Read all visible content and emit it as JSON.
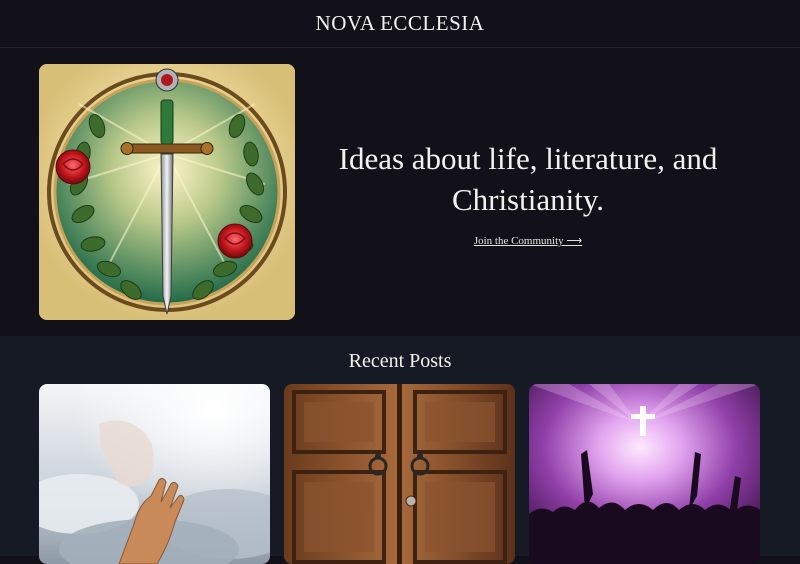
{
  "header": {
    "site_title": "NOVA ECCLESIA"
  },
  "hero": {
    "image_icon": "sword-rose-wreath-emblem",
    "tagline": "Ideas about life, literature, and Christianity.",
    "cta_label": "Join the Community ⟶"
  },
  "recent_posts": {
    "heading": "Recent Posts",
    "cards": [
      {
        "image": "hands-reaching-through-clouds"
      },
      {
        "image": "old-wooden-church-doors"
      },
      {
        "image": "worship-concert-crowd-with-cross"
      }
    ]
  },
  "colors": {
    "background": "#121119",
    "recent_background": "#151a24",
    "text": "#f4f2ee"
  }
}
